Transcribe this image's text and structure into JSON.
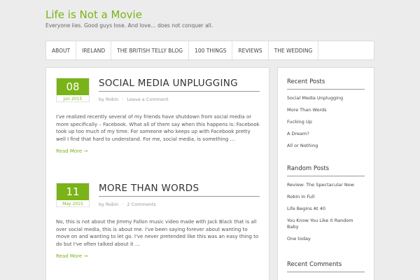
{
  "site": {
    "title": "Life is Not a Movie",
    "tagline": "Everyone lies. Good guys lose. And love… does not conquer all."
  },
  "nav": {
    "items": [
      "About",
      "Ireland",
      "The British Telly Blog",
      "100 Things",
      "Reviews",
      "The Wedding"
    ]
  },
  "posts": [
    {
      "day": "08",
      "month": "Jun 2015",
      "title": "SOCIAL MEDIA UNPLUGGING",
      "meta_by": "by Robin",
      "meta_sep": "·",
      "meta_comments": "Leave a Comment",
      "excerpt": "I've realized recently several of my friends have shutdown from social media or more specifically – Facebook. What all of them say when this happens is: Facebook took up too much of my time. For someone who keeps up with Facebook pretty well I find that hard to understand. For me, social media, is something …",
      "read_more": "Read More →"
    },
    {
      "day": "11",
      "month": "May 2015",
      "title": "MORE THAN WORDS",
      "meta_by": "by Robin",
      "meta_sep": "·",
      "meta_comments": "2 Comments",
      "excerpt": "No, this is not about the Jimmy Fallon music video made with Jack Black that is all over social media, this is about me. I've been saying forever about wanting to move on and wanting to let go. I've never pretended like this was an easy thing to do but I've often talked about it …",
      "read_more": "Read More →"
    }
  ],
  "sidebar": {
    "recent_posts": {
      "title": "Recent Posts",
      "items": [
        "Social Media Unplugging",
        "More Than Words",
        "Fucking Up",
        "A Dream?",
        "All or Nothing"
      ]
    },
    "random_posts": {
      "title": "Random Posts",
      "items": [
        "Review: The Spectacular Now",
        "Robin In Full",
        "Life Begins At 40",
        "You Know You Like it Random Baby",
        "One today"
      ]
    },
    "recent_comments": {
      "title": "Recent Comments"
    }
  }
}
